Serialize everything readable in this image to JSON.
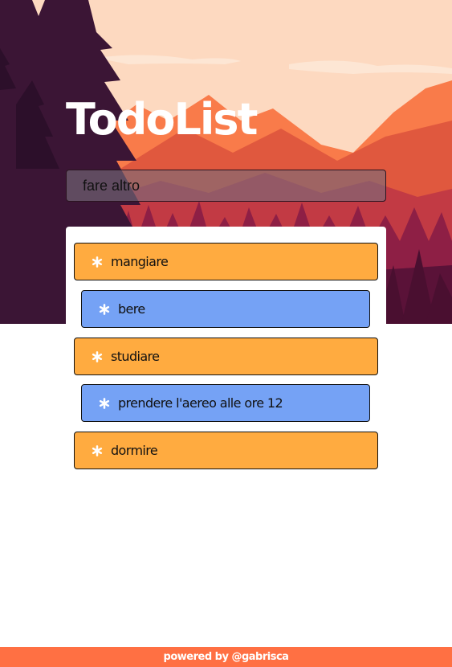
{
  "app": {
    "title": "TodoList"
  },
  "input": {
    "value": "fare altro"
  },
  "todos": [
    {
      "label": "mangiare",
      "color": "#ffab40"
    },
    {
      "label": "bere",
      "color": "#75a2f5"
    },
    {
      "label": "studiare",
      "color": "#ffab40"
    },
    {
      "label": "prendere l'aereo alle ore 12",
      "color": "#75a2f5"
    },
    {
      "label": "dormire",
      "color": "#ffab40"
    }
  ],
  "footer": {
    "text": "powered by @gabrisca",
    "color": "#ff7043"
  },
  "icons": {
    "item_icon": "asterisk-icon"
  }
}
